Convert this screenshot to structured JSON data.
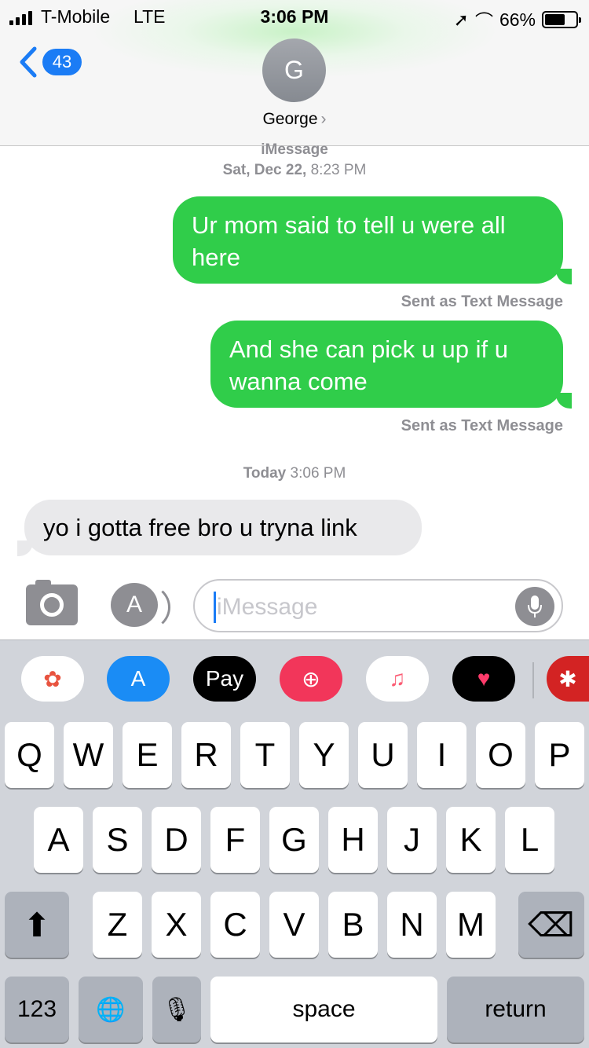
{
  "status_bar": {
    "carrier": "T-Mobile",
    "network": "LTE",
    "time": "3:06 PM",
    "battery": "66%",
    "battery_level": 0.66,
    "icons": [
      "signal-bars-icon",
      "location-arrow-icon",
      "headphones-icon",
      "battery-icon"
    ]
  },
  "nav": {
    "back_count": "43",
    "avatar_initial": "G",
    "contact_name": "George",
    "chevron": "›"
  },
  "conversation": {
    "service_label": "iMessage",
    "date_day": "Sat, Dec 22,",
    "date_time": "8:23 PM",
    "messages": [
      {
        "from": "me",
        "text": "Ur mom said to tell u were all here",
        "status": "Sent as Text Message",
        "color": "#30cd4a"
      },
      {
        "from": "me",
        "text": "And she can pick u up if u wanna come",
        "status": "Sent as Text Message",
        "color": "#30cd4a"
      },
      {
        "from": "them",
        "text": "yo i gotta free bro u tryna link",
        "color": "#e9e9eb"
      }
    ],
    "today_label": "Today",
    "today_time": "3:06 PM"
  },
  "composer": {
    "placeholder": "iMessage",
    "icons": [
      "camera-icon",
      "app-store-icon",
      "microphone-icon"
    ]
  },
  "app_strip": {
    "apps": [
      {
        "name": "photos-app",
        "label": "✿",
        "bg": "#ffffff",
        "fg": "#e8533f"
      },
      {
        "name": "app-store-app",
        "label": "A",
        "bg": "#1a8cf5",
        "fg": "#ffffff"
      },
      {
        "name": "apple-pay-app",
        "label": "Pay",
        "bg": "#000000",
        "fg": "#ffffff"
      },
      {
        "name": "web-search-app",
        "label": "⊕",
        "bg": "#f2365a",
        "fg": "#ffffff"
      },
      {
        "name": "music-app",
        "label": "♫",
        "bg": "#ffffff",
        "fg": "#fb5c74"
      },
      {
        "name": "digital-touch-app",
        "label": "♥",
        "bg": "#000000",
        "fg": "#ff3b6b"
      },
      {
        "name": "yelp-app",
        "label": "✱",
        "bg": "#d32323",
        "fg": "#ffffff"
      }
    ]
  },
  "keyboard": {
    "row1": [
      "Q",
      "W",
      "E",
      "R",
      "T",
      "Y",
      "U",
      "I",
      "O",
      "P"
    ],
    "row2": [
      "A",
      "S",
      "D",
      "F",
      "G",
      "H",
      "J",
      "K",
      "L"
    ],
    "row3": [
      "Z",
      "X",
      "C",
      "V",
      "B",
      "N",
      "M"
    ],
    "shift": "⬆",
    "delete": "⌫",
    "numbers": "123",
    "globe": "🌐",
    "dictation": "🎙",
    "space": "space",
    "return": "return"
  }
}
